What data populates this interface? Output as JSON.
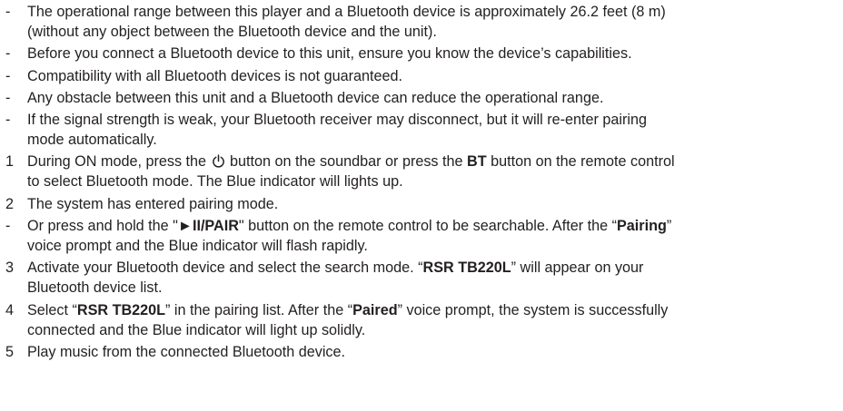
{
  "items": [
    {
      "marker": "-",
      "l1": "The operational range between this player and a Bluetooth device is approximately 26.2 feet (8 m)",
      "l2": "(without any object between the Bluetooth device and the unit)."
    },
    {
      "marker": "-",
      "l1": "Before you connect a Bluetooth device to this unit, ensure you know the device’s capabilities."
    },
    {
      "marker": "-",
      "l1": "Compatibility with all Bluetooth devices is not guaranteed."
    },
    {
      "marker": "-",
      "l1": "Any obstacle between this unit and a Bluetooth device can reduce the operational range."
    },
    {
      "marker": "-",
      "l1": "If the signal strength is weak, your Bluetooth receiver may disconnect, but it will re-enter pairing",
      "l2": "mode automatically."
    },
    {
      "marker": "1",
      "a": "During ON mode, press the",
      "b": "button on the soundbar or press the",
      "c": "BT",
      "d": "button on the remote control",
      "l2": "to select Bluetooth mode. The Blue indicator will lights up."
    },
    {
      "marker": "2",
      "l1": "The system has entered pairing mode."
    },
    {
      "marker": "-",
      "a": "Or press and hold the \"",
      "b": "►II/PAIR",
      "c": "\" button on the remote control to be searchable. After the “",
      "d": "Pairing",
      "e": "”",
      "l2": "voice prompt and the Blue indicator will flash rapidly."
    },
    {
      "marker": "3",
      "a": "Activate your Bluetooth device and select the search mode. “",
      "b": "RSR TB220L",
      "c": "” will appear on your",
      "l2": "Bluetooth device list."
    },
    {
      "marker": "4",
      "a": "Select “",
      "b": "RSR TB220L",
      "c": "” in the pairing list. After the “",
      "d": "Paired",
      "e": "” voice prompt, the system is successfully",
      "l2": "connected and the Blue indicator will light up solidly."
    },
    {
      "marker": "5",
      "l1": "Play music from the connected Bluetooth device."
    }
  ],
  "icons": {
    "power": "power-icon"
  }
}
